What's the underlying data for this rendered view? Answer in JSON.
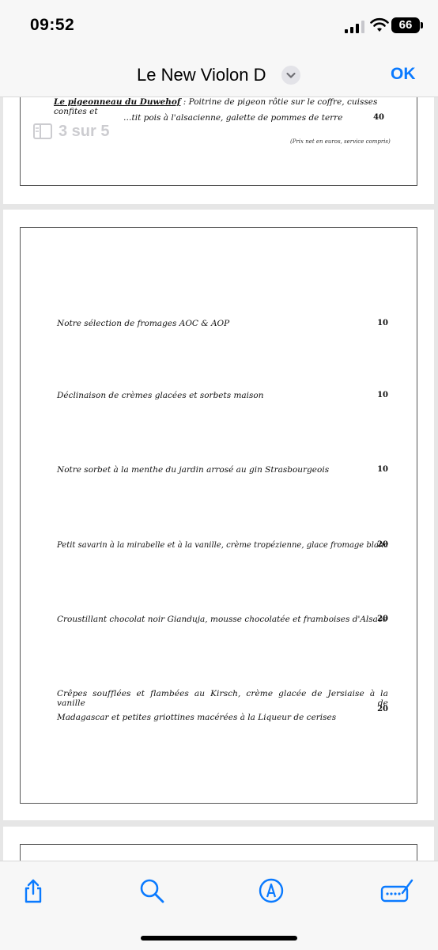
{
  "status": {
    "time": "09:52",
    "battery": "66"
  },
  "nav": {
    "title": "Le New Violon D",
    "ok": "OK"
  },
  "page_indicator": "3 sur 5",
  "previous_page": {
    "dish_name": "Le pigeonneau du Duwehof",
    "dish_desc_line1": " : Poitrine de pigeon rôtie sur le coffre, cuisses confites et",
    "dish_desc_line2": "…tit pois à l'alsacienne, galette de pommes de terre",
    "price": "40",
    "note": "(Prix net en euros, service compris)"
  },
  "menu_items": [
    {
      "text": "Notre sélection de fromages AOC & AOP",
      "price": "10"
    },
    {
      "text": "Déclinaison de crèmes glacées et sorbets maison",
      "price": "10"
    },
    {
      "text": "Notre sorbet à la menthe du jardin arrosé au gin Strasbourgeois",
      "price": "10"
    },
    {
      "text": "Petit savarin à la mirabelle et à la vanille, crème tropézienne, glace fromage blanc",
      "price": "20"
    },
    {
      "text": "Croustillant chocolat noir Gianduja, mousse chocolatée et framboises d'Alsace",
      "price": "20"
    },
    {
      "text_line1": "Crêpes soufflées et flambées au Kirsch, crème glacée de Jersiaise à la vanille de",
      "text_line2": "Madagascar et petites griottines macérées à la Liqueur de cerises",
      "price": "20"
    }
  ],
  "toolbar": {
    "share": "share-icon",
    "search": "search-icon",
    "markup": "markup-icon",
    "more": "keyboard-icon"
  },
  "colors": {
    "accent": "#0a7aff"
  }
}
